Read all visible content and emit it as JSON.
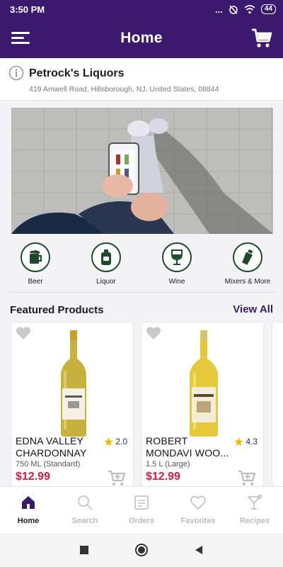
{
  "status_bar": {
    "time": "3:50 PM",
    "dots": "...",
    "battery": "44"
  },
  "app_bar": {
    "title": "Home"
  },
  "store": {
    "name": "Petrock's Liquors",
    "address": "419 Amwell Road, Hillsborough, NJ, United States, 08844"
  },
  "categories": [
    {
      "label": "Beer",
      "icon": "beer-mug-icon"
    },
    {
      "label": "Liquor",
      "icon": "liquor-bottle-icon"
    },
    {
      "label": "Wine",
      "icon": "wine-glass-icon"
    },
    {
      "label": "Mixers & More",
      "icon": "shaker-icon"
    }
  ],
  "featured": {
    "title": "Featured Products",
    "view_all": "View All",
    "products": [
      {
        "name_line1": "EDNA VALLEY",
        "name_line2": "CHARDONNAY",
        "rating": "2.0",
        "size": "750 ML (Standard)",
        "price": "$12.99"
      },
      {
        "name_line1": "ROBERT",
        "name_line2": "MONDAVI WOO...",
        "rating": "4.3",
        "size": "1.5 L (Large)",
        "price": "$12.99"
      }
    ]
  },
  "bottom_nav": [
    {
      "label": "Home",
      "active": true
    },
    {
      "label": "Search",
      "active": false
    },
    {
      "label": "Orders",
      "active": false
    },
    {
      "label": "Favorites",
      "active": false
    },
    {
      "label": "Recipes",
      "active": false
    }
  ],
  "colors": {
    "primary": "#3b1a6e",
    "accent_green": "#1f4a2a",
    "price_red": "#d81b3a",
    "star": "#f2b705"
  }
}
